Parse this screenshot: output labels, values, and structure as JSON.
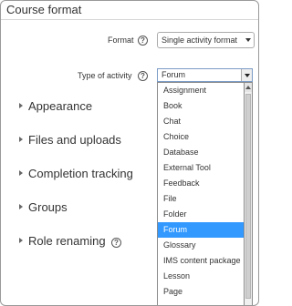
{
  "section": {
    "title": "Course format"
  },
  "format_field": {
    "label": "Format",
    "value": "Single activity format",
    "help_symbol": "?"
  },
  "type_field": {
    "label": "Type of activity",
    "value": "Forum",
    "help_symbol": "?"
  },
  "dropdown": {
    "options": [
      "Assignment",
      "Book",
      "Chat",
      "Choice",
      "Database",
      "External Tool",
      "Feedback",
      "File",
      "Folder",
      "Forum",
      "Glossary",
      "IMS content package",
      "Lesson",
      "Page"
    ],
    "selected": "Forum"
  },
  "sections": {
    "appearance": "Appearance",
    "files": "Files and uploads",
    "completion": "Completion tracking",
    "groups": "Groups",
    "role_renaming": "Role renaming",
    "role_help_symbol": "?"
  },
  "colors": {
    "selected_highlight": "#3399ff",
    "border": "#9a9a9a"
  }
}
